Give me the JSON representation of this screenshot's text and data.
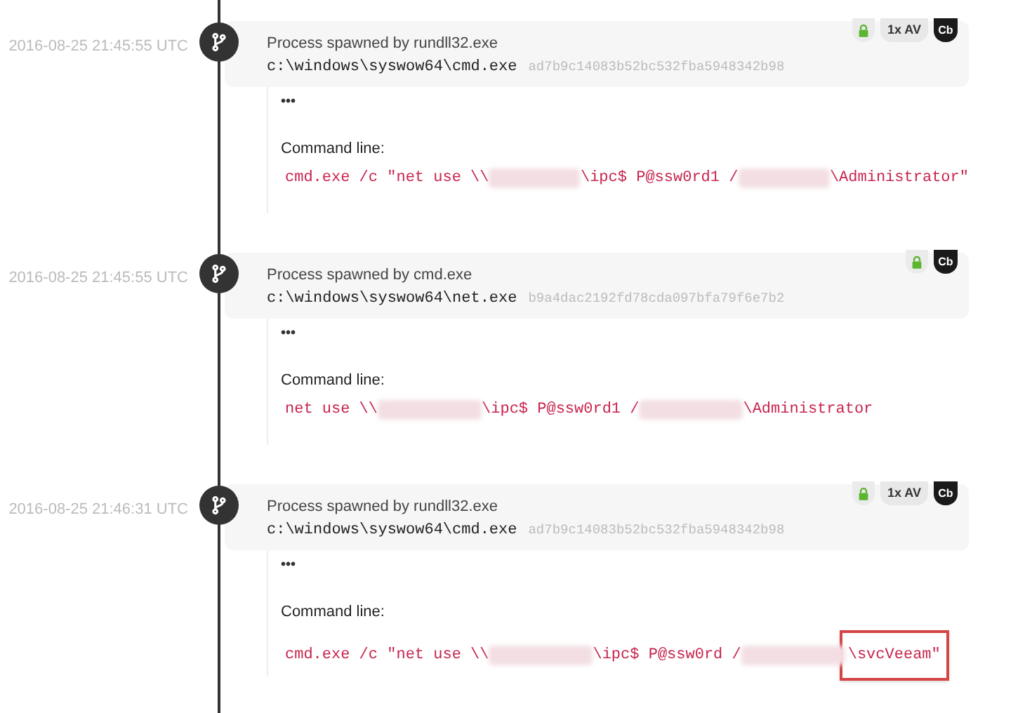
{
  "events": [
    {
      "timestamp": "2016-08-25 21:45:55 UTC",
      "title": "Process spawned by rundll32.exe",
      "path": "c:\\windows\\syswow64\\cmd.exe",
      "hash": "ad7b9c14083b52bc532fba5948342b98",
      "badges": [
        {
          "kind": "lock"
        },
        {
          "kind": "text",
          "label": "1x AV"
        },
        {
          "kind": "dark",
          "label": "Cb"
        }
      ],
      "more": "•••",
      "command_label": "Command line:",
      "command": [
        {
          "kind": "text",
          "text": "cmd.exe /c \"net use \\\\"
        },
        {
          "kind": "redacted"
        },
        {
          "kind": "text",
          "text": "\\ipc$ P@ssw0rd1 /"
        },
        {
          "kind": "redacted"
        },
        {
          "kind": "text",
          "text": "\\Administrator\""
        }
      ]
    },
    {
      "timestamp": "2016-08-25 21:45:55 UTC",
      "title": "Process spawned by cmd.exe",
      "path": "c:\\windows\\syswow64\\net.exe",
      "hash": "b9a4dac2192fd78cda097bfa79f6e7b2",
      "badges": [
        {
          "kind": "lock"
        },
        {
          "kind": "dark",
          "label": "Cb"
        }
      ],
      "more": "•••",
      "command_label": "Command line:",
      "command": [
        {
          "kind": "text",
          "text": "net use \\\\"
        },
        {
          "kind": "redacted"
        },
        {
          "kind": "text",
          "text": "\\ipc$ P@ssw0rd1 /"
        },
        {
          "kind": "redacted"
        },
        {
          "kind": "text",
          "text": "\\Administrator"
        }
      ]
    },
    {
      "timestamp": "2016-08-25 21:46:31 UTC",
      "title": "Process spawned by rundll32.exe",
      "path": "c:\\windows\\syswow64\\cmd.exe",
      "hash": "ad7b9c14083b52bc532fba5948342b98",
      "badges": [
        {
          "kind": "lock"
        },
        {
          "kind": "text",
          "label": "1x AV"
        },
        {
          "kind": "dark",
          "label": "Cb"
        }
      ],
      "more": "•••",
      "command_label": "Command line:",
      "command": [
        {
          "kind": "text",
          "text": "cmd.exe /c \"net use \\\\"
        },
        {
          "kind": "redacted"
        },
        {
          "kind": "text",
          "text": "\\ipc$ P@ssw0rd /"
        },
        {
          "kind": "redacted"
        },
        {
          "kind": "highlighted",
          "text": "\\svcVeeam\""
        }
      ]
    }
  ]
}
